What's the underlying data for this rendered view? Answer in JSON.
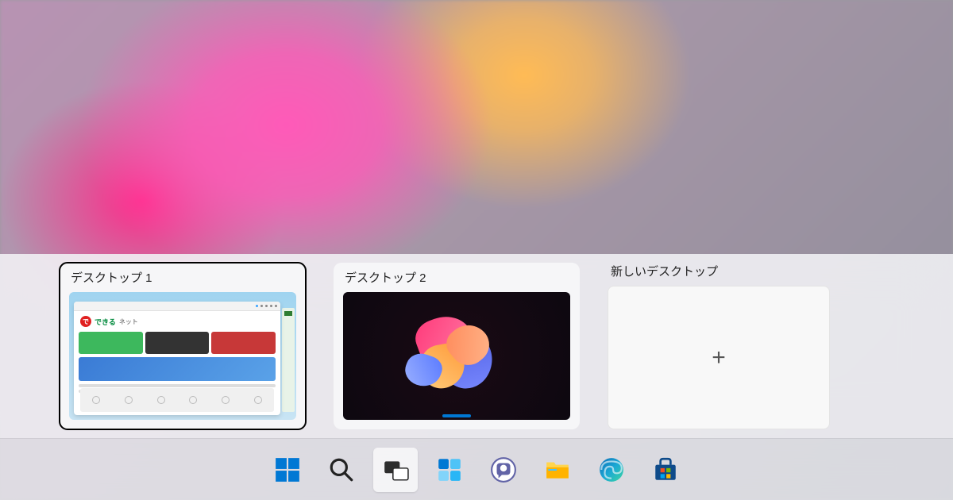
{
  "desktops": {
    "d1": {
      "label": "デスクトップ 1",
      "preview_brand": "できる",
      "preview_brand_sub": "ネット"
    },
    "d2": {
      "label": "デスクトップ 2"
    },
    "new": {
      "label": "新しいデスクトップ"
    }
  },
  "taskbar": {
    "start": "start-icon",
    "search": "search-icon",
    "taskview": "taskview-icon",
    "widgets": "widgets-icon",
    "chat": "chat-icon",
    "explorer": "file-explorer-icon",
    "edge": "edge-icon",
    "store": "store-icon"
  }
}
